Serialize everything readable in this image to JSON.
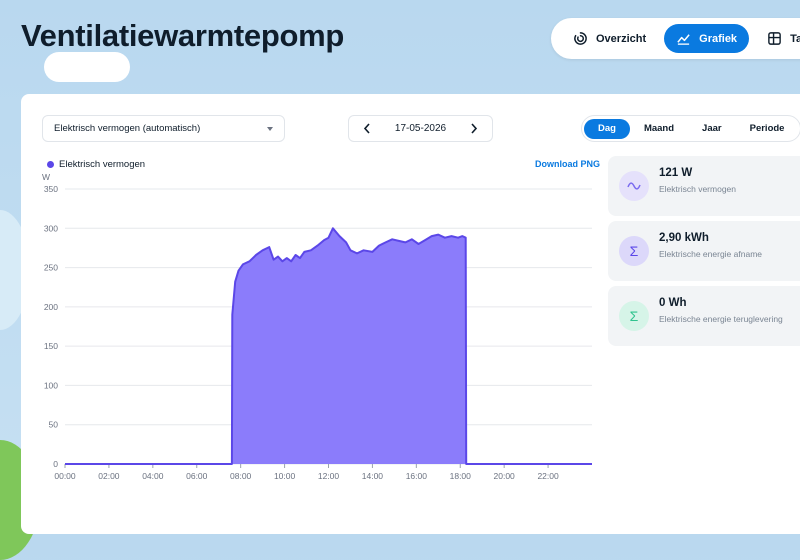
{
  "page": {
    "title": "Ventilatiewarmtepomp"
  },
  "topnav": {
    "items": [
      {
        "label": "Overzicht",
        "icon": "gauge-icon"
      },
      {
        "label": "Grafiek",
        "icon": "chart-icon",
        "active": true
      },
      {
        "label": "Tabel",
        "icon": "table-icon"
      }
    ]
  },
  "controls": {
    "metric_select": "Elektrisch vermogen (automatisch)",
    "date": "17-05-2026",
    "periods": [
      {
        "label": "Dag",
        "active": true
      },
      {
        "label": "Maand"
      },
      {
        "label": "Jaar"
      },
      {
        "label": "Periode"
      }
    ]
  },
  "chart": {
    "legend": "Elektrisch vermogen",
    "download": "Download PNG",
    "unit": "W"
  },
  "stats": [
    {
      "value": "121 W",
      "label": "Elektrisch vermogen",
      "icon": "wave-icon",
      "color": "#7b6cf0",
      "bg": "#e5e1fb"
    },
    {
      "value": "2,90 kWh",
      "label": "Elektrische energie afname",
      "icon": "sigma-icon",
      "color": "#5b47e8",
      "bg": "#dcd8fa"
    },
    {
      "value": "0 Wh",
      "label": "Elektrische energie teruglevering",
      "icon": "sigma-icon",
      "color": "#2fc38e",
      "bg": "#d6f4e8"
    }
  ],
  "colors": {
    "accent": "#0a7ae0",
    "series": "#5b47e8",
    "fill": "#8b7cfb"
  },
  "chart_data": {
    "type": "area",
    "ylabel": "W",
    "ylim": [
      0,
      350
    ],
    "yticks": [
      0,
      50,
      100,
      150,
      200,
      250,
      300,
      350
    ],
    "xticks": [
      "00:00",
      "02:00",
      "04:00",
      "06:00",
      "08:00",
      "10:00",
      "12:00",
      "14:00",
      "16:00",
      "18:00",
      "20:00",
      "22:00"
    ],
    "xlim": [
      0,
      24
    ],
    "series": [
      {
        "name": "Elektrisch vermogen",
        "x": [
          0,
          7.6,
          7.62,
          7.75,
          7.9,
          8.1,
          8.4,
          8.7,
          9.0,
          9.3,
          9.5,
          9.7,
          9.9,
          10.1,
          10.3,
          10.5,
          10.7,
          10.9,
          11.2,
          11.5,
          11.8,
          12.0,
          12.2,
          12.5,
          12.8,
          13.0,
          13.3,
          13.6,
          14.0,
          14.3,
          14.6,
          14.9,
          15.2,
          15.5,
          15.8,
          16.1,
          16.4,
          16.7,
          17.0,
          17.3,
          17.6,
          17.9,
          18.1,
          18.25,
          18.27,
          24
        ],
        "y": [
          0,
          0,
          190,
          232,
          246,
          254,
          258,
          266,
          272,
          276,
          260,
          264,
          258,
          262,
          258,
          266,
          262,
          270,
          272,
          278,
          285,
          288,
          300,
          290,
          282,
          272,
          268,
          272,
          270,
          278,
          282,
          286,
          284,
          282,
          286,
          280,
          285,
          290,
          292,
          288,
          290,
          288,
          290,
          288,
          0,
          0
        ]
      }
    ]
  }
}
